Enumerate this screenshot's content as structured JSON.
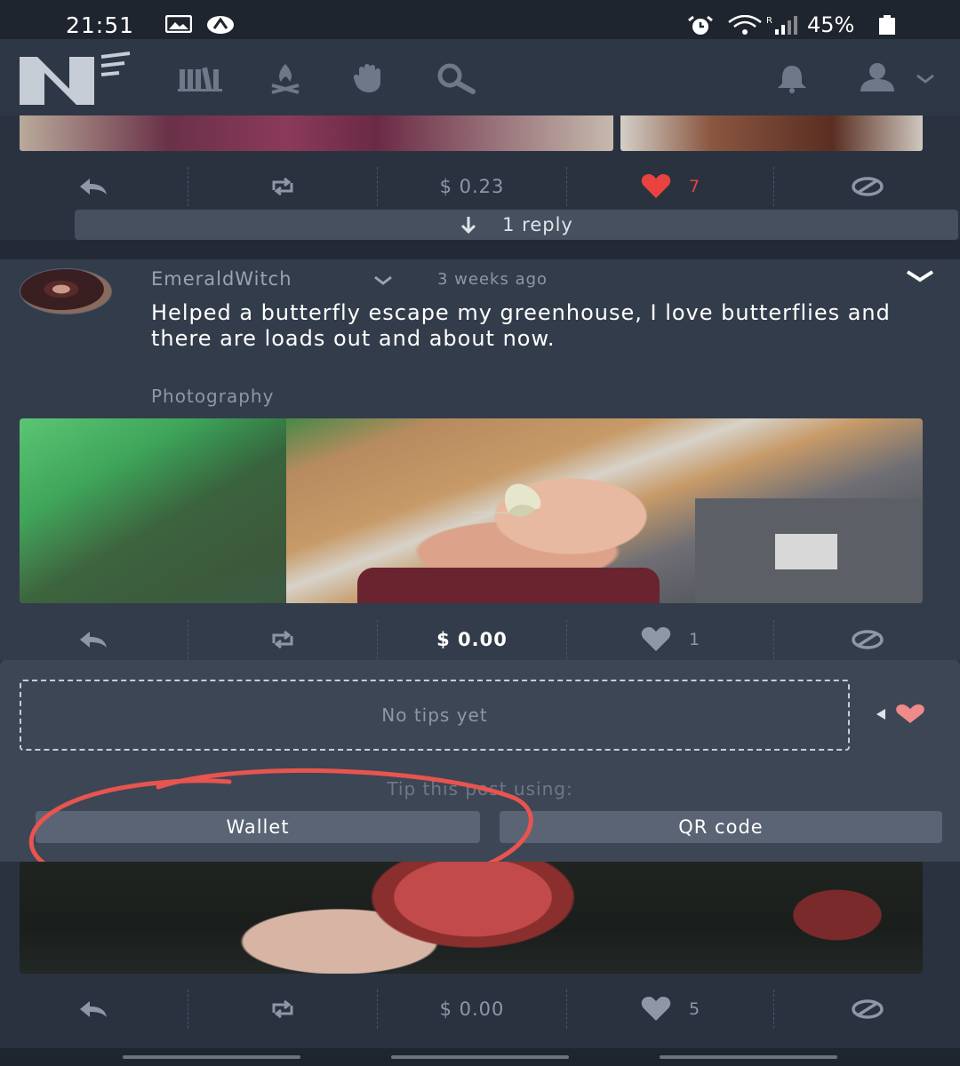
{
  "status_bar": {
    "time": "21:51",
    "battery": "45%"
  },
  "post1": {
    "tip_amount": "$ 0.23",
    "likes": "7",
    "replies_label": "1 reply"
  },
  "post2": {
    "author": "EmeraldWitch",
    "time": "3 weeks ago",
    "text": "Helped a butterfly escape my greenhouse, I love butterflies and there are loads out and about now.",
    "tag": "Photography",
    "tip_amount": "$ 0.00",
    "likes": "1"
  },
  "tips": {
    "empty_text": "No tips yet",
    "prompt": "Tip this post using:",
    "wallet_label": "Wallet",
    "qr_label": "QR code"
  },
  "post3": {
    "tip_amount": "$ 0.00",
    "likes": "5"
  },
  "colors": {
    "like_red": "#e8433f",
    "annotation_red": "#e8544f",
    "tip_heart": "#f08a8a"
  }
}
